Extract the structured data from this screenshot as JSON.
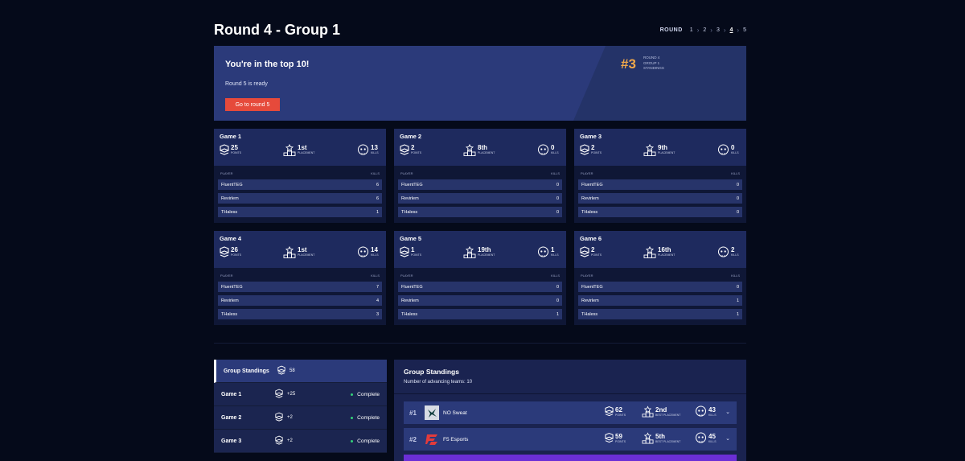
{
  "header": {
    "title": "Round 4 - Group 1",
    "round_label": "ROUND",
    "rounds": [
      "1",
      "2",
      "3",
      "4",
      "5"
    ],
    "current_round": "4"
  },
  "banner": {
    "heading": "You're in the top 10!",
    "subtext": "Round 5 is ready",
    "button_label": "Go to round 5",
    "rank": "#3",
    "rank_line1": "ROUND 4",
    "rank_line2": "GROUP 1",
    "rank_line3": "STANDINGS"
  },
  "labels": {
    "points": "POINTS",
    "placement": "PLACEMENT",
    "kills": "KILLS",
    "player": "PLAYER",
    "best_placement": "BEST PLACEMENT"
  },
  "games": [
    {
      "name": "Game 1",
      "points": "25",
      "placement": "1st",
      "kills": "13",
      "players": [
        {
          "name": "FluentTEG",
          "kills": "6"
        },
        {
          "name": "Revirlem",
          "kills": "6"
        },
        {
          "name": "THaless",
          "kills": "1"
        }
      ]
    },
    {
      "name": "Game 2",
      "points": "2",
      "placement": "8th",
      "kills": "0",
      "players": [
        {
          "name": "FluentTEG",
          "kills": "0"
        },
        {
          "name": "Revirlem",
          "kills": "0"
        },
        {
          "name": "THaless",
          "kills": "0"
        }
      ]
    },
    {
      "name": "Game 3",
      "points": "2",
      "placement": "9th",
      "kills": "0",
      "players": [
        {
          "name": "FluentTEG",
          "kills": "0"
        },
        {
          "name": "Revirlem",
          "kills": "0"
        },
        {
          "name": "THaless",
          "kills": "0"
        }
      ]
    },
    {
      "name": "Game 4",
      "points": "26",
      "placement": "1st",
      "kills": "14",
      "players": [
        {
          "name": "FluentTEG",
          "kills": "7"
        },
        {
          "name": "Revirlem",
          "kills": "4"
        },
        {
          "name": "THaless",
          "kills": "3"
        }
      ]
    },
    {
      "name": "Game 5",
      "points": "1",
      "placement": "19th",
      "kills": "1",
      "players": [
        {
          "name": "FluentTEG",
          "kills": "0"
        },
        {
          "name": "Revirlem",
          "kills": "0"
        },
        {
          "name": "THaless",
          "kills": "1"
        }
      ]
    },
    {
      "name": "Game 6",
      "points": "2",
      "placement": "16th",
      "kills": "2",
      "players": [
        {
          "name": "FluentTEG",
          "kills": "0"
        },
        {
          "name": "Revirlem",
          "kills": "1"
        },
        {
          "name": "THaless",
          "kills": "1"
        }
      ]
    }
  ],
  "sidebar": {
    "items": [
      {
        "label": "Group Standings",
        "value": "58",
        "status": ""
      },
      {
        "label": "Game 1",
        "value": "+25",
        "status": "Complete"
      },
      {
        "label": "Game 2",
        "value": "+2",
        "status": "Complete"
      },
      {
        "label": "Game 3",
        "value": "+2",
        "status": "Complete"
      }
    ]
  },
  "standings": {
    "title": "Group Standings",
    "advancing": "Number of advancing teams: 10",
    "teams": [
      {
        "rank": "#1",
        "name": "NO Sweat",
        "points": "62",
        "best_placement": "2nd",
        "kills": "43"
      },
      {
        "rank": "#2",
        "name": "F5 Esports",
        "points": "59",
        "best_placement": "5th",
        "kills": "45"
      }
    ]
  },
  "colors": {
    "background": "#050a1a",
    "banner": "#2b3a7a",
    "accent_button": "#e64a3b",
    "rank_color": "#f2a94a",
    "complete_dot": "#33d17a",
    "highlight_row": "#6b2fd6"
  }
}
